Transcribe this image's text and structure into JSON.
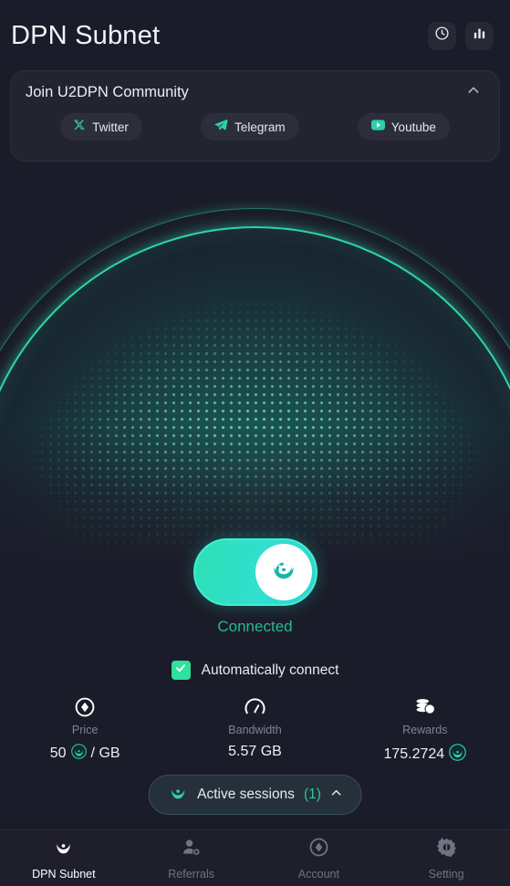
{
  "theme": {
    "background": "#1b1c29",
    "card_bg": "#23242f",
    "accent_teal": "#2ee0b5",
    "accent_green": "#2fe09e",
    "text_primary": "#eef0f5",
    "text_muted": "#7d8496",
    "connected_color": "#24ba93"
  },
  "header": {
    "title": "DPN Subnet",
    "actions": [
      {
        "name": "history-button",
        "icon": "clock-icon"
      },
      {
        "name": "stats-button",
        "icon": "bar-chart-icon"
      }
    ]
  },
  "community": {
    "title": "Join U2DPN Community",
    "collapse_icon": "chevron-up-icon",
    "links": [
      {
        "label": "Twitter",
        "icon": "x-twitter-icon"
      },
      {
        "label": "Telegram",
        "icon": "telegram-icon"
      },
      {
        "label": "Youtube",
        "icon": "youtube-icon"
      }
    ]
  },
  "connection": {
    "toggle_state": "on",
    "status_label": "Connected",
    "auto_connect": {
      "label": "Automatically connect",
      "checked": true
    }
  },
  "stats": [
    {
      "key": "price",
      "icon": "diamond-circle-icon",
      "label": "Price",
      "value": "50",
      "suffix": "/ GB",
      "has_coin": true
    },
    {
      "key": "bandwidth",
      "icon": "speedometer-icon",
      "label": "Bandwidth",
      "value": "5.57 GB",
      "suffix": "",
      "has_coin": false
    },
    {
      "key": "rewards",
      "icon": "coins-icon",
      "label": "Rewards",
      "value": "175.2724",
      "suffix": "",
      "has_coin": true
    }
  ],
  "sessions": {
    "icon": "u2dpn-logo-icon",
    "label": "Active sessions",
    "count": "(1)",
    "expand_icon": "chevron-up-icon"
  },
  "bottom_nav": [
    {
      "label": "DPN Subnet",
      "icon": "u2dpn-logo-icon",
      "active": true
    },
    {
      "label": "Referrals",
      "icon": "user-add-icon",
      "active": false
    },
    {
      "label": "Account",
      "icon": "diamond-circle-icon",
      "active": false
    },
    {
      "label": "Setting",
      "icon": "gear-icon",
      "active": false
    }
  ]
}
